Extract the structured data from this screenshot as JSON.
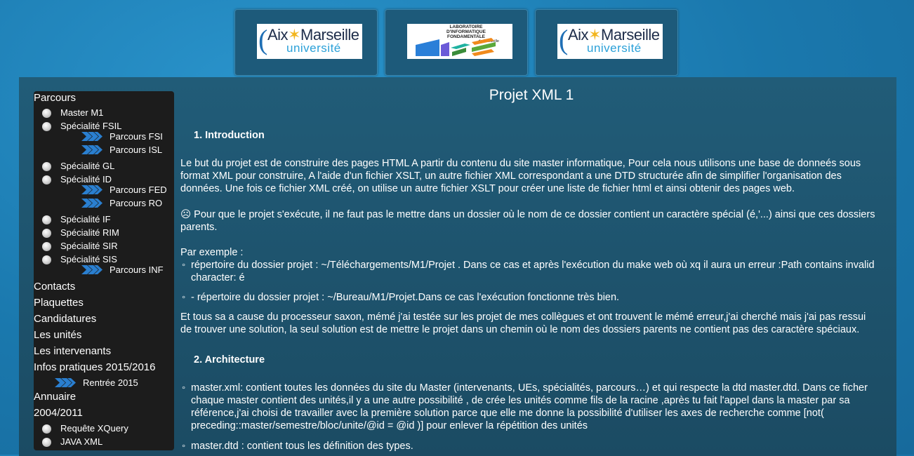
{
  "logos": [
    {
      "kind": "amu",
      "top": "Aix",
      "star": "✶",
      "top2": "Marseille",
      "bottom": "université"
    },
    {
      "kind": "lif",
      "line1": "LABORATOIRE",
      "line2": "D'INFORMATIQUE",
      "line3": "FONDAMENTALE",
      "line4": "de Marseille"
    },
    {
      "kind": "amu",
      "top": "Aix",
      "star": "✶",
      "top2": "Marseille",
      "bottom": "université"
    }
  ],
  "sidebar": {
    "parcours": "Parcours",
    "master_m1": "Master M1",
    "fsil": "Spécialité FSIL",
    "parcours_fsi": "Parcours FSI",
    "parcours_isl": "Parcours ISL",
    "gl": "Spécialité GL",
    "id": "Spécialité ID",
    "parcours_fed": "Parcours FED",
    "parcours_ro": "Parcours RO",
    "if": "Spécialité IF",
    "rim": "Spécialité RIM",
    "sir": "Spécialité SIR",
    "sis": "Spécialité SIS",
    "parcours_inf": "Parcours INF",
    "contacts": "Contacts",
    "plaquettes": "Plaquettes",
    "candidatures": "Candidatures",
    "unites": "Les unités",
    "intervenants": "Les intervenants",
    "infos": "Infos pratiques 2015/2016",
    "rentree": "Rentrée 2015",
    "annuaire": "Annuaire",
    "year": "2004/2011",
    "xquery": "Requête XQuery",
    "java": "JAVA XML"
  },
  "content": {
    "title": "Projet XML 1",
    "h1_num": "1.",
    "h1": "Introduction",
    "p1": "Le but du projet est de construire des pages HTML A partir du contenu du site master informatique, Pour cela nous utilisons une base de donneés sous format XML pour construire, A l'aide d'un fichier XSLT, un autre fichier XML correspondant a une DTD structurée afin de simplifier l'organisation des données. Une fois ce fichier XML créé, on utilise un autre fichier XSLT pour créer une liste de fichier html et ainsi obtenir des pages web.",
    "p2": "☹ Pour que le projet s'exécute, il ne faut pas le mettre dans un dossier où le nom de ce dossier contient un caractère spécial (é,'...) ainsi que ces dossiers parents.",
    "p3": "Par exemple :",
    "li1": "répertoire du dossier projet : ~/Téléchargements/M1/Projet . Dans ce cas et après l'exécution du make web où xq il aura un erreur :Path contains invalid character: é",
    "li2": "- répertoire du dossier projet : ~/Bureau/M1/Projet.Dans ce cas l'exécution fonctionne très bien.",
    "p4": "Et tous sa a cause du processeur saxon, mémé j'ai testée sur les projet de mes collègues et ont trouvent le mémé erreur,j'ai cherché mais j'ai pas ressui de trouver une solution, la seul solution est de mettre le projet dans un chemin où le nom des dossiers parents ne contient pas des caractère spéciaux.",
    "h2_num": "2.",
    "h2": "Architecture",
    "li3": "master.xml: contient toutes les données du site du Master (intervenants, UEs, spécialités, parcours…) et qui respecte la dtd master.dtd. Dans ce ficher chaque master contient des unités,il y a une autre possibilité , de crée les unités comme fils de la racine ,après tu fait l'appel dans la master par sa référence,j'ai choisi de travailler avec la première solution parce que elle me donne la possibilité d'utiliser les axes de recherche comme [not( preceding::master/semestre/bloc/unite/@id = @id )] pour enlever la répétition des unités",
    "li4": "master.dtd : contient tous les définition des types.",
    "bullet": "◦"
  },
  "colors": {
    "page_bg": "#1d7fb5",
    "panel_bg": "#1c4e66",
    "sidebar_bg": "#1c1c1c",
    "arrow": "#2a7fd0"
  }
}
